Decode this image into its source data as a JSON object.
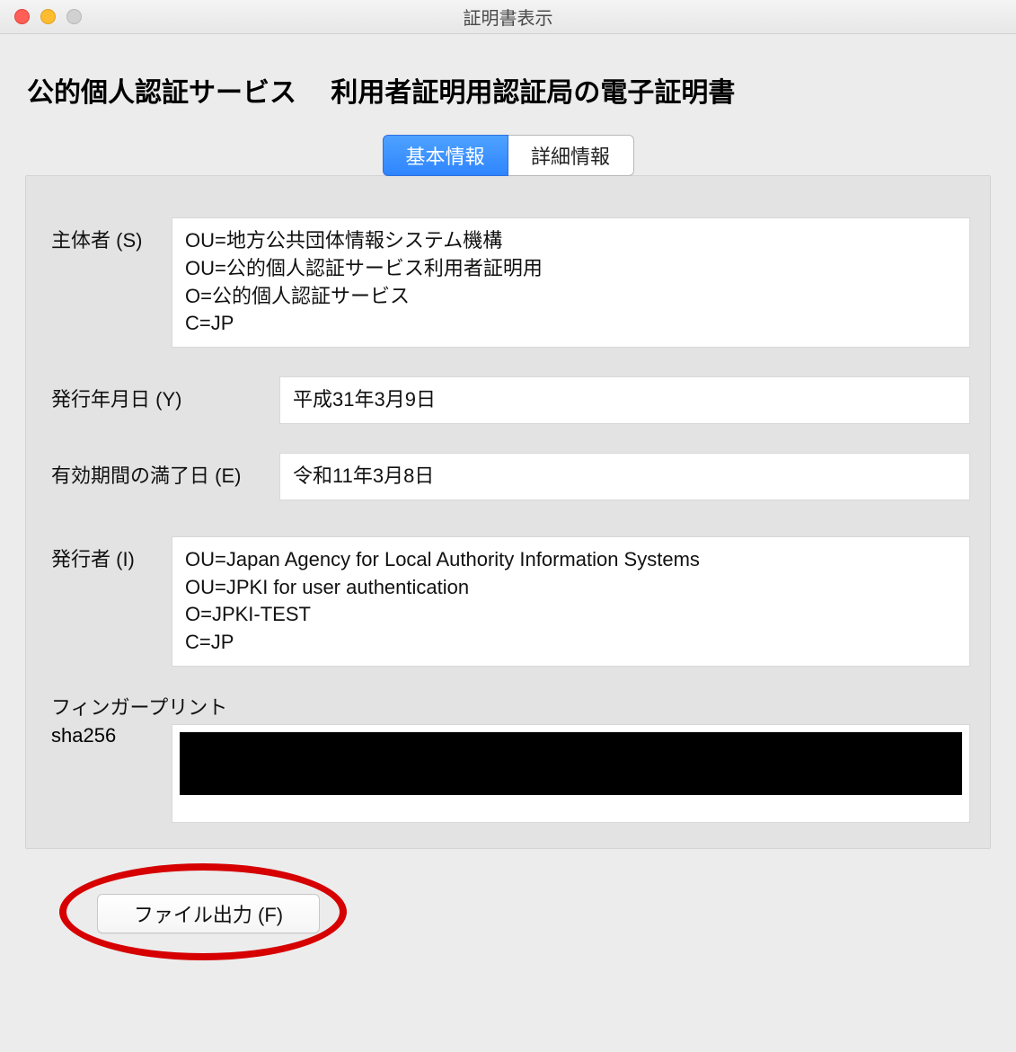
{
  "window": {
    "title": "証明書表示"
  },
  "page": {
    "title": "公的個人認証サービス　 利用者証明用認証局の電子証明書"
  },
  "tabs": {
    "basic": "基本情報",
    "detail": "詳細情報",
    "active": "basic"
  },
  "fields": {
    "subject": {
      "label": "主体者 (S)",
      "value": "OU=地方公共団体情報システム機構\nOU=公的個人認証サービス利用者証明用\nO=公的個人認証サービス\nC=JP"
    },
    "issue_date": {
      "label": "発行年月日 (Y)",
      "value": "平成31年3月9日"
    },
    "expiry_date": {
      "label": "有効期間の満了日 (E)",
      "value": "令和11年3月8日"
    },
    "issuer": {
      "label": "発行者 (I)",
      "value": "OU=Japan Agency for Local Authority Information Systems\nOU=JPKI for user authentication\nO=JPKI-TEST\nC=JP"
    },
    "fingerprint": {
      "label": "フィンガープリント",
      "algorithm": "sha256",
      "value": ""
    }
  },
  "buttons": {
    "export": "ファイル出力 (F)"
  }
}
